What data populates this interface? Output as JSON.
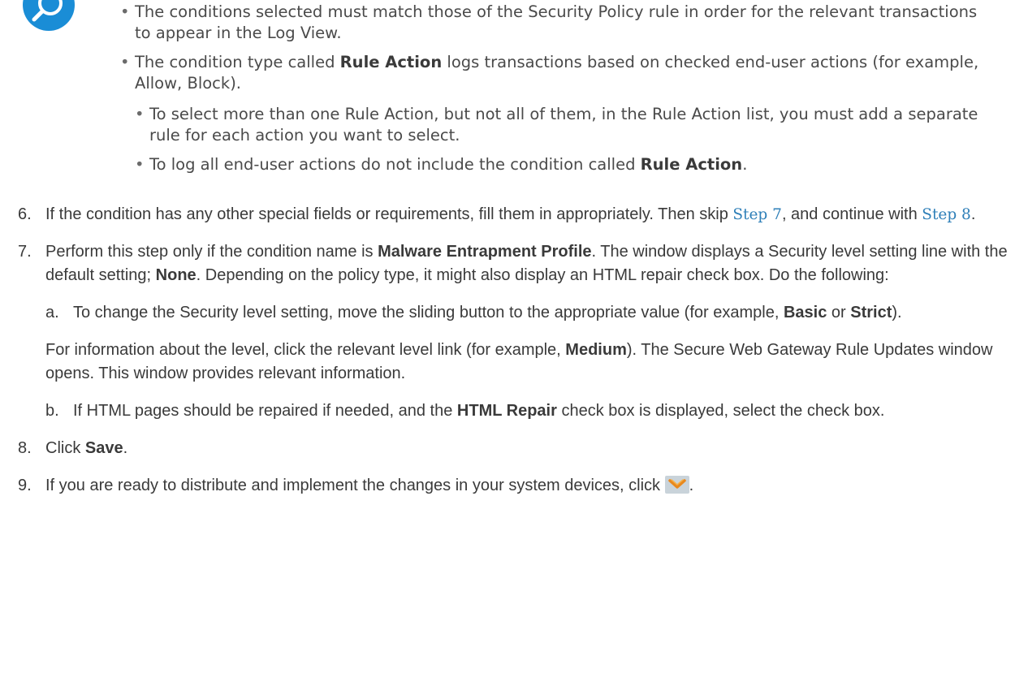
{
  "note": {
    "icon": "magnifier-icon",
    "bullet1": "The conditions selected must match those of the Security Policy rule in order for the relevant transactions to appear in the Log View.",
    "bullet2_pre": "The condition type called ",
    "bullet2_bold": "Rule Action",
    "bullet2_post": " logs transactions based on checked end-user actions (for example, Allow, Block).",
    "sub1": "To select more than one Rule Action, but not all of them, in the Rule Action list, you must add a separate rule for each action you want to select.",
    "sub2_pre": "To log all end-user actions do not include the condition called ",
    "sub2_bold": "Rule Action",
    "sub2_post": "."
  },
  "steps": {
    "s6": {
      "num": "6.",
      "pre": "If the condition has any other special fields or requirements, fill them in appropriately. Then skip ",
      "link1": "Step 7",
      "mid": ", and continue with ",
      "link2": "Step 8",
      "post": "."
    },
    "s7": {
      "num": "7.",
      "t1": "Perform this step only if the condition name is ",
      "b1": "Malware Entrapment Profile",
      "t2": ". The window displays a Security level setting line with the default setting; ",
      "b2": "None",
      "t3": ". Depending on the policy type, it might also display an HTML repair check box. Do the following:",
      "a_num": "a.",
      "a_t1": "To change the Security level setting, move the sliding button to the appropriate value (for example, ",
      "a_b1": "Basic",
      "a_t2": " or ",
      "a_b2": "Strict",
      "a_t3": ").",
      "info_t1": "For information about the level, click the relevant level link (for example, ",
      "info_b1": "Medium",
      "info_t2": "). The Secure Web Gateway Rule Updates window opens. This window provides relevant information.",
      "b_num": "b.",
      "b_t1": "If HTML pages should be repaired if needed, and the ",
      "b_b1": "HTML Repair",
      "b_t2": " check box is displayed, select the check box."
    },
    "s8": {
      "num": "8.",
      "t1": "Click ",
      "b1": "Save",
      "t2": "."
    },
    "s9": {
      "num": "9.",
      "t1": "If you are ready to distribute and implement the changes in your system devices, click ",
      "icon": "distribute-icon",
      "t2": "."
    }
  }
}
